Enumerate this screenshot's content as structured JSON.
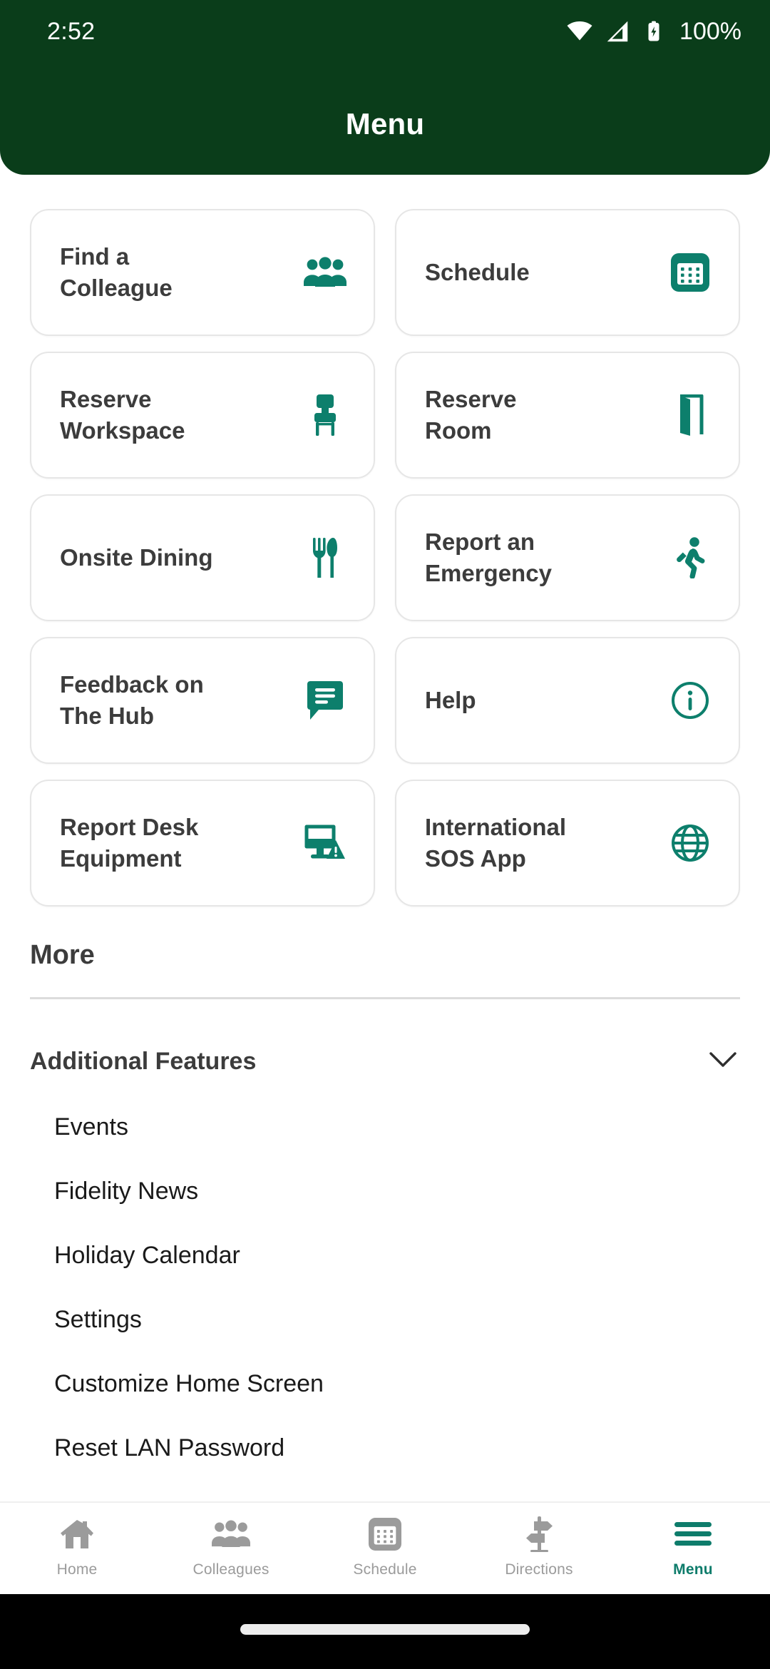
{
  "status_bar": {
    "time": "2:52",
    "battery_percent": "100%",
    "icons": [
      "wifi-icon",
      "cellular-signal-icon",
      "battery-charging-icon"
    ]
  },
  "header": {
    "title": "Menu",
    "background_color": "#0A3D1A"
  },
  "theme": {
    "accent_teal": "#0E7C6B",
    "header_green": "#0A3D1A",
    "card_text": "#3C3C3C",
    "card_border": "#E6E6E6",
    "nav_inactive": "#9B9B9B"
  },
  "grid": {
    "cards": [
      {
        "label": "Find a\nColleague",
        "icon": "group-people-icon"
      },
      {
        "label": "Schedule",
        "icon": "calendar-icon"
      },
      {
        "label": "Reserve\nWorkspace",
        "icon": "chair-icon"
      },
      {
        "label": "Reserve\nRoom",
        "icon": "door-icon"
      },
      {
        "label": "Onsite Dining",
        "icon": "fork-knife-icon"
      },
      {
        "label": "Report an\nEmergency",
        "icon": "running-person-icon"
      },
      {
        "label": "Feedback on\nThe Hub",
        "icon": "chat-bubble-icon"
      },
      {
        "label": "Help",
        "icon": "info-circle-icon"
      },
      {
        "label": "Report Desk\nEquipment",
        "icon": "monitor-warning-icon"
      },
      {
        "label": "International\nSOS App",
        "icon": "globe-icon"
      }
    ]
  },
  "more_section": {
    "heading": "More",
    "accordion": {
      "label": "Additional Features",
      "chevron_icon": "chevron-down-icon",
      "expanded": true,
      "items": [
        "Events",
        "Fidelity News",
        "Holiday Calendar",
        "Settings",
        "Customize Home Screen",
        "Reset LAN Password"
      ]
    }
  },
  "bottom_nav": {
    "items": [
      {
        "label": "Home",
        "icon": "home-icon",
        "active": false
      },
      {
        "label": "Colleagues",
        "icon": "people-icon",
        "active": false
      },
      {
        "label": "Schedule",
        "icon": "calendar-icon",
        "active": false
      },
      {
        "label": "Directions",
        "icon": "signpost-icon",
        "active": false
      },
      {
        "label": "Menu",
        "icon": "hamburger-menu-icon",
        "active": true
      }
    ]
  }
}
